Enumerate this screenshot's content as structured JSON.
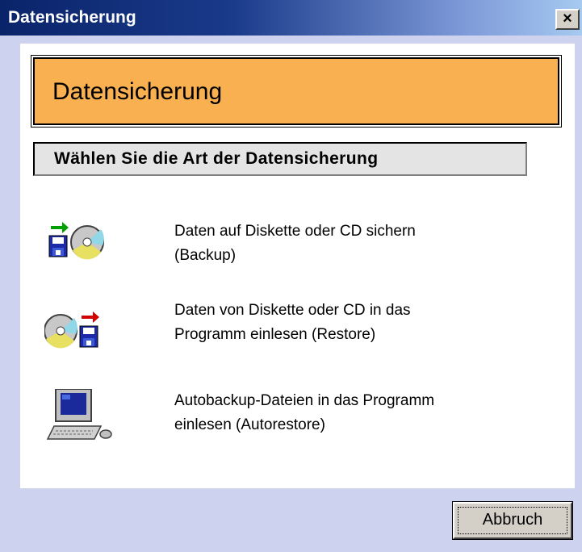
{
  "window": {
    "title": "Datensicherung",
    "close_label": "×"
  },
  "header": {
    "title": "Datensicherung"
  },
  "subheader": {
    "text": "Wählen Sie die Art der Datensicherung"
  },
  "options": [
    {
      "line1": "Daten auf Diskette oder CD sichern",
      "line2": "(Backup)",
      "icon": "backup-to-disk-icon"
    },
    {
      "line1": "Daten von Diskette oder CD in das",
      "line2": "Programm einlesen (Restore)",
      "icon": "restore-from-disk-icon"
    },
    {
      "line1": "Autobackup-Dateien in das Programm",
      "line2": "einlesen (Autorestore)",
      "icon": "computer-icon"
    }
  ],
  "footer": {
    "cancel_label": "Abbruch"
  },
  "colors": {
    "titlebar": "#0a246a",
    "header_bg": "#f9b050",
    "window_bg": "#cdd3ee"
  }
}
